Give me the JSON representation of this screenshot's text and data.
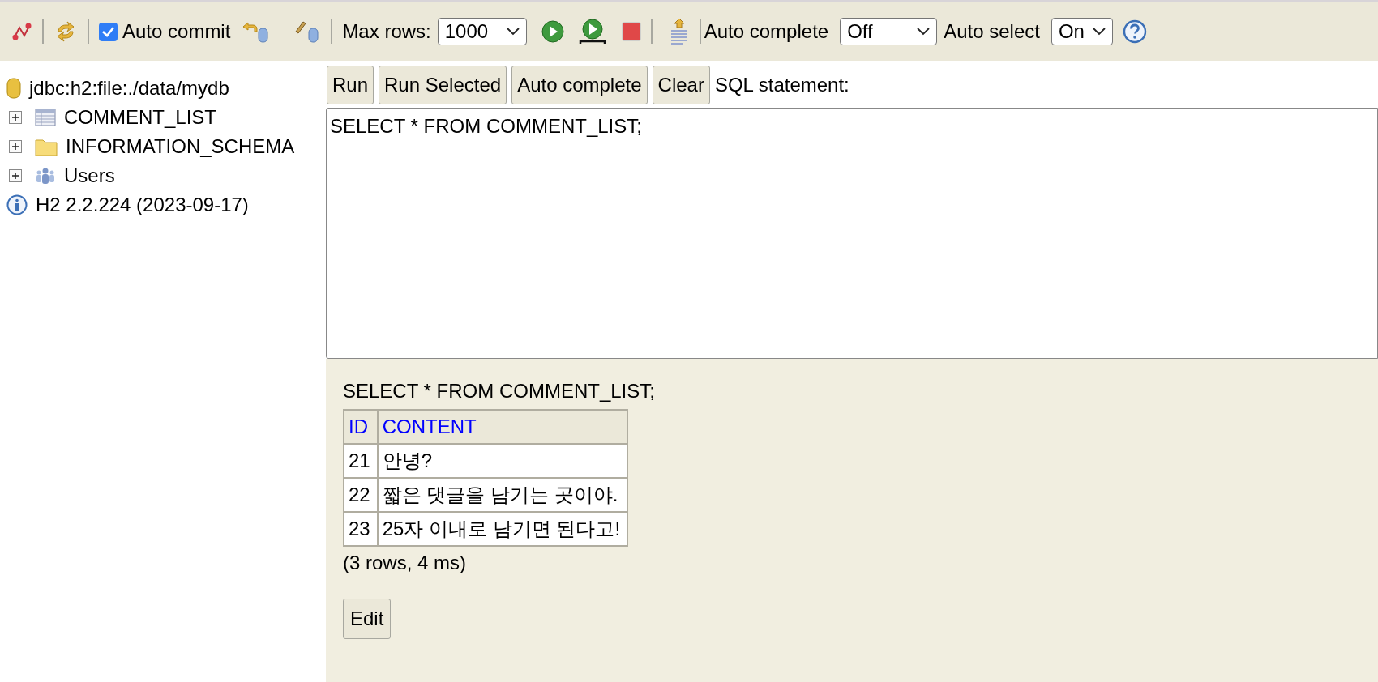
{
  "toolbar": {
    "auto_commit": {
      "label": "Auto commit",
      "checked": true
    },
    "max_rows": {
      "label": "Max rows:",
      "value": "1000"
    },
    "auto_complete": {
      "label": "Auto complete",
      "value": "Off"
    },
    "auto_select": {
      "label": "Auto select",
      "value": "On"
    }
  },
  "tree": [
    {
      "kind": "connection",
      "label": "jdbc:h2:file:./data/mydb"
    },
    {
      "kind": "table",
      "label": "COMMENT_LIST",
      "expanded": false
    },
    {
      "kind": "folder",
      "label": "INFORMATION_SCHEMA",
      "expanded": false
    },
    {
      "kind": "users",
      "label": "Users",
      "expanded": false
    },
    {
      "kind": "info",
      "label": "H2 2.2.224 (2023-09-17)"
    }
  ],
  "buttons": [
    "Run",
    "Run Selected",
    "Auto complete",
    "Clear"
  ],
  "sql_label": "SQL statement:",
  "editor": {
    "value": "SELECT * FROM COMMENT_LIST;"
  },
  "result": {
    "query": "SELECT * FROM COMMENT_LIST;",
    "columns": [
      "ID",
      "CONTENT"
    ],
    "rows": [
      [
        "21",
        "안녕?"
      ],
      [
        "22",
        "짧은 댓글을 남기는 곳이야."
      ],
      [
        "23",
        "25자 이내로 남기면 된다고!"
      ]
    ],
    "summary": "(3 rows, 4 ms)",
    "edit_button": "Edit"
  }
}
